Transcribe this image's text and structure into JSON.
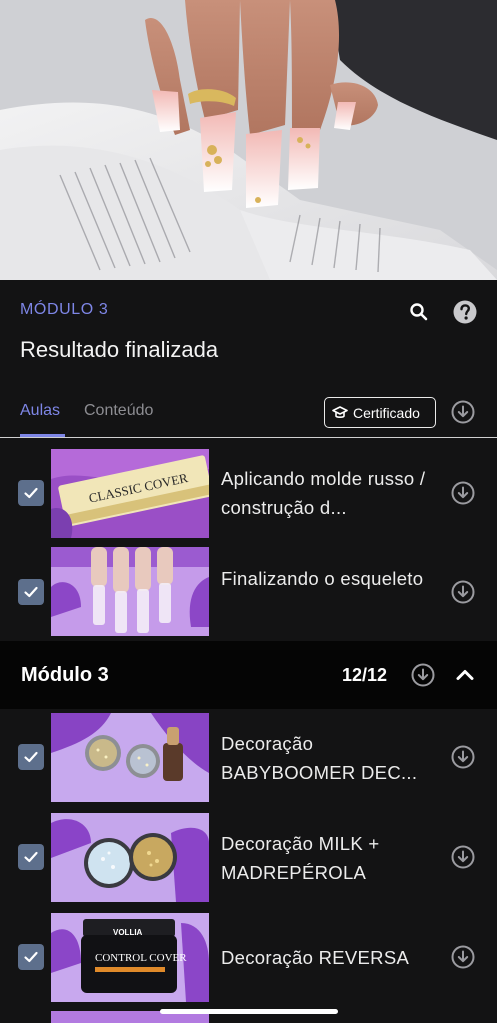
{
  "header": {
    "module_label": "MÓDULO 3",
    "course_title": "Resultado finalizada"
  },
  "tabs": {
    "aulas": "Aulas",
    "conteudo": "Conteúdo",
    "certificate_label": "Certificado"
  },
  "lessons_top": [
    {
      "title": "Aplicando molde russo / construção d...",
      "completed": true
    },
    {
      "title": "Finalizando o esqueleto",
      "completed": true
    }
  ],
  "module": {
    "name": "Módulo 3",
    "progress": "12/12",
    "expanded": true
  },
  "lessons_module": [
    {
      "title": "Decoração BABYBOOMER DEC...",
      "completed": true
    },
    {
      "title": "Decoração MILK + MADREPÉROLA",
      "completed": true
    },
    {
      "title": "Decoração REVERSA",
      "completed": true
    }
  ],
  "thumb_labels": {
    "classic_cover": "CLASSIC COVER",
    "vollia": "VOLLIA",
    "control_cover": "CONTROL COVER"
  },
  "icons": [
    "search-icon",
    "help-icon",
    "certificate-icon",
    "download-icon",
    "checkbox-icon",
    "chevron-up-icon"
  ],
  "colors": {
    "accent": "#7e86e6",
    "background": "#131314",
    "module_bar": "#050505",
    "checkbox": "#5d6f8c"
  }
}
